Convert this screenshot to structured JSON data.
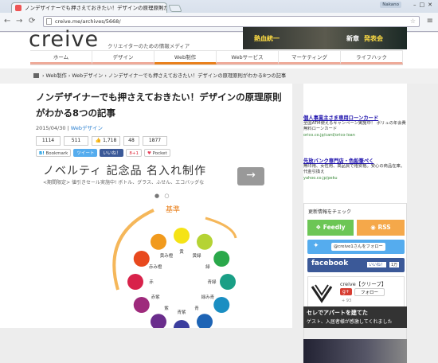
{
  "browser": {
    "tab_title": "ノンデザイナーでも押さえておきたい！デザインの原理原則が",
    "user_label": "Nakano",
    "url": "creive.me/archives/5668/"
  },
  "site": {
    "logo": "creive",
    "tagline": "クリエイターのための情報メディア",
    "banner_text_1": "熱血統一",
    "banner_text_2": "新章",
    "banner_text_3": "発表会"
  },
  "nav": [
    "ホーム",
    "デザイン",
    "Web制作",
    "Webサービス",
    "マーケティング",
    "ライフハック"
  ],
  "breadcrumb": [
    "Web制作",
    "Webデザイン",
    "ノンデザイナーでも押さえておきたい！デザインの原理原則がわかる8つの記事"
  ],
  "article": {
    "title": "ノンデザイナーでも押さえておきたい！デザインの原理原則がわかる8つの記事",
    "date": "2015/04/30",
    "category": "Webデザイン",
    "counts": [
      "1114",
      "511",
      "1,718",
      "48",
      "1877"
    ],
    "share": {
      "bookmark": "Bookmark",
      "tweet": "ツイート",
      "like": "いいね！",
      "gplus": "8+1",
      "pocket": "Pocket"
    },
    "ad_title": "ノベルティ 記念品 名入れ制作",
    "ad_sub": "<期間限定> 値引きセール実施中! ボトル、グラス、ふせん、エコバッグな",
    "ad_arrow": "→",
    "wheel": {
      "label_top": "基準",
      "colors": [
        "黄",
        "黄緑",
        "緑",
        "青緑",
        "緑み青",
        "青",
        "青紫",
        "紫",
        "赤紫",
        "赤",
        "赤み橙",
        "黄み橙"
      ]
    }
  },
  "sidebar": {
    "ad1_title": "個人事業主さま専用ローンカード",
    "ad1_text": "全国ATM使えるキャンペーン実施中！ ボリュの年会費無料ローンカード",
    "ad1_url": "orico.co.jp/card/orico-loan",
    "ad2_title": "先放バンク専門店・色鉛筆ぺく",
    "ad2_text": "無印用、女性用、高品質で格安格。安心の商品在庫。代金引換え",
    "ad2_url": "yahoo.co.jp/peku",
    "follow_title": "更新情報をチェック",
    "feedly": "Feedly",
    "rss": "RSS",
    "twitter_follow": "@creive1さんをフォロー",
    "facebook": "facebook",
    "fb_like": "いいね！",
    "fb_count": "1万",
    "gplus_name": "creive【クリープ】",
    "gplus_follow": "フォロー",
    "gplus_g": "g+",
    "gplus_count": "+ 93",
    "bottom_ad_1": "セレでアパートを建てた",
    "bottom_ad_2": "ゲスト、入居者様が感激してくれました"
  }
}
